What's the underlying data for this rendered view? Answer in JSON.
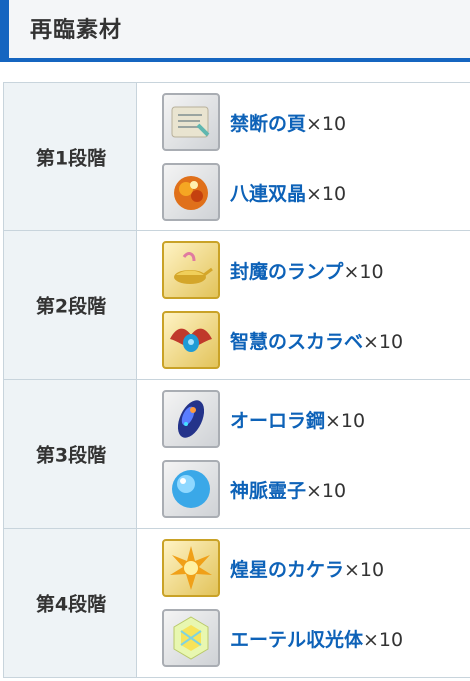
{
  "header": {
    "title": "再臨素材"
  },
  "stages": [
    {
      "label": "第1段階",
      "items": [
        {
          "name": "禁断の頁",
          "qty": "×10",
          "icon": "forbidden-page-icon",
          "frame": "silver"
        },
        {
          "name": "八連双晶",
          "qty": "×10",
          "icon": "octuplet-crystals-icon",
          "frame": "silver"
        }
      ]
    },
    {
      "label": "第2段階",
      "items": [
        {
          "name": "封魔のランプ",
          "qty": "×10",
          "icon": "magic-lamp-icon",
          "frame": "gold"
        },
        {
          "name": "智慧のスカラベ",
          "qty": "×10",
          "icon": "scarab-icon",
          "frame": "gold"
        }
      ]
    },
    {
      "label": "第3段階",
      "items": [
        {
          "name": "オーロラ鋼",
          "qty": "×10",
          "icon": "aurora-steel-icon",
          "frame": "silver"
        },
        {
          "name": "神脈霊子",
          "qty": "×10",
          "icon": "divine-spiritron-icon",
          "frame": "silver"
        }
      ]
    },
    {
      "label": "第4段階",
      "items": [
        {
          "name": "煌星のカケラ",
          "qty": "×10",
          "icon": "star-shard-icon",
          "frame": "gold"
        },
        {
          "name": "エーテル収光体",
          "qty": "×10",
          "icon": "ether-crystal-icon",
          "frame": "silver"
        }
      ]
    }
  ],
  "colors": {
    "accent": "#1565c0",
    "link": "#0d62b8",
    "stage_bg": "#eef3f6",
    "border": "#c8d4dc"
  }
}
